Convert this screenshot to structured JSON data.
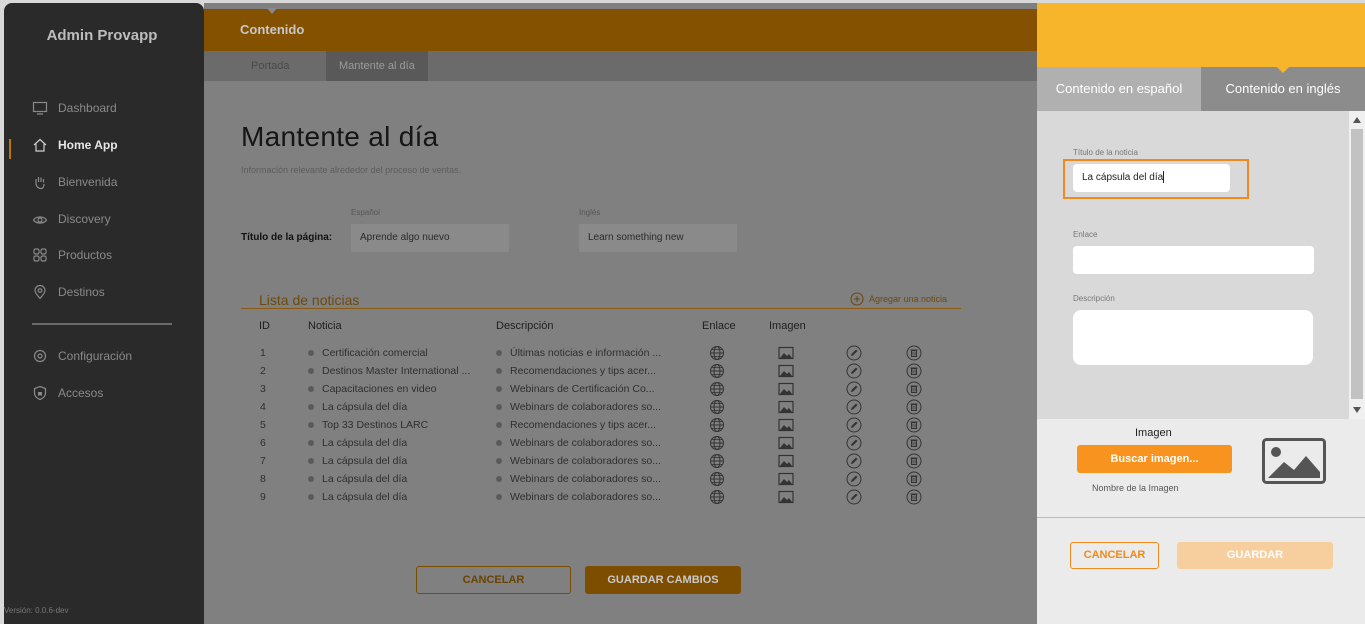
{
  "sidebar": {
    "brand": "Admin Provapp",
    "items": [
      {
        "label": "Dashboard",
        "icon": "monitor-icon"
      },
      {
        "label": "Home App",
        "icon": "home-icon",
        "active": true
      },
      {
        "label": "Bienvenida",
        "icon": "hand-icon"
      },
      {
        "label": "Discovery",
        "icon": "eye-icon"
      },
      {
        "label": "Productos",
        "icon": "grid-icon"
      },
      {
        "label": "Destinos",
        "icon": "map-pin-icon"
      },
      {
        "label": "Configuración",
        "icon": "gear-icon"
      },
      {
        "label": "Accesos",
        "icon": "shield-icon"
      }
    ],
    "version": "Versión: 0.0.6-dev"
  },
  "main": {
    "section": "Contenido",
    "tabs": [
      "Portada",
      "Mantente al día"
    ],
    "page_title": "Mantente al día",
    "page_subtitle": "Información relevante alrededor del proceso de ventas.",
    "title_label": "Título de la página:",
    "lang_es": "Español",
    "lang_en": "Inglés",
    "title_es": "Aprende algo nuevo",
    "title_en": "Learn something new",
    "list_title": "Lista de noticias",
    "add_news": "Agregar una noticia",
    "columns": [
      "ID",
      "Noticia",
      "Descripción",
      "Enlace",
      "Imagen"
    ],
    "rows": [
      {
        "id": "1",
        "noticia": "Certificación comercial",
        "descripcion": "Últimas noticias e información ..."
      },
      {
        "id": "2",
        "noticia": "Destinos Master International ...",
        "descripcion": "Recomendaciones y tips acer..."
      },
      {
        "id": "3",
        "noticia": "Capacitaciones en video",
        "descripcion": "Webinars de Certificación Co..."
      },
      {
        "id": "4",
        "noticia": "La cápsula del día",
        "descripcion": "Webinars de colaboradores so..."
      },
      {
        "id": "5",
        "noticia": "Top 33 Destinos LARC",
        "descripcion": "Recomendaciones y tips acer..."
      },
      {
        "id": "6",
        "noticia": "La cápsula del día",
        "descripcion": "Webinars de colaboradores so..."
      },
      {
        "id": "7",
        "noticia": "La cápsula del día",
        "descripcion": "Webinars de colaboradores so..."
      },
      {
        "id": "8",
        "noticia": "La cápsula del día",
        "descripcion": "Webinars de colaboradores so..."
      },
      {
        "id": "9",
        "noticia": "La cápsula del día",
        "descripcion": "Webinars de colaboradores so..."
      }
    ],
    "cancel_label": "CANCELAR",
    "save_label": "GUARDAR CAMBIOS"
  },
  "panel": {
    "tabs": [
      "Contenido en español",
      "Contenido en inglés"
    ],
    "active_tab": 1,
    "title_label": "Título de la noticia",
    "title_value": "La cápsula del día",
    "link_label": "Enlace",
    "link_value": "",
    "desc_label": "Descripción",
    "desc_value": "",
    "image_label": "Imagen",
    "browse_label": "Buscar imagen...",
    "image_name_label": "Nombre de la Imagen",
    "cancel_label": "CANCELAR",
    "save_label": "GUARDAR"
  },
  "colors": {
    "accent": "#f7931e",
    "header": "#f7b52b",
    "sidebar": "#2a2a2a"
  }
}
